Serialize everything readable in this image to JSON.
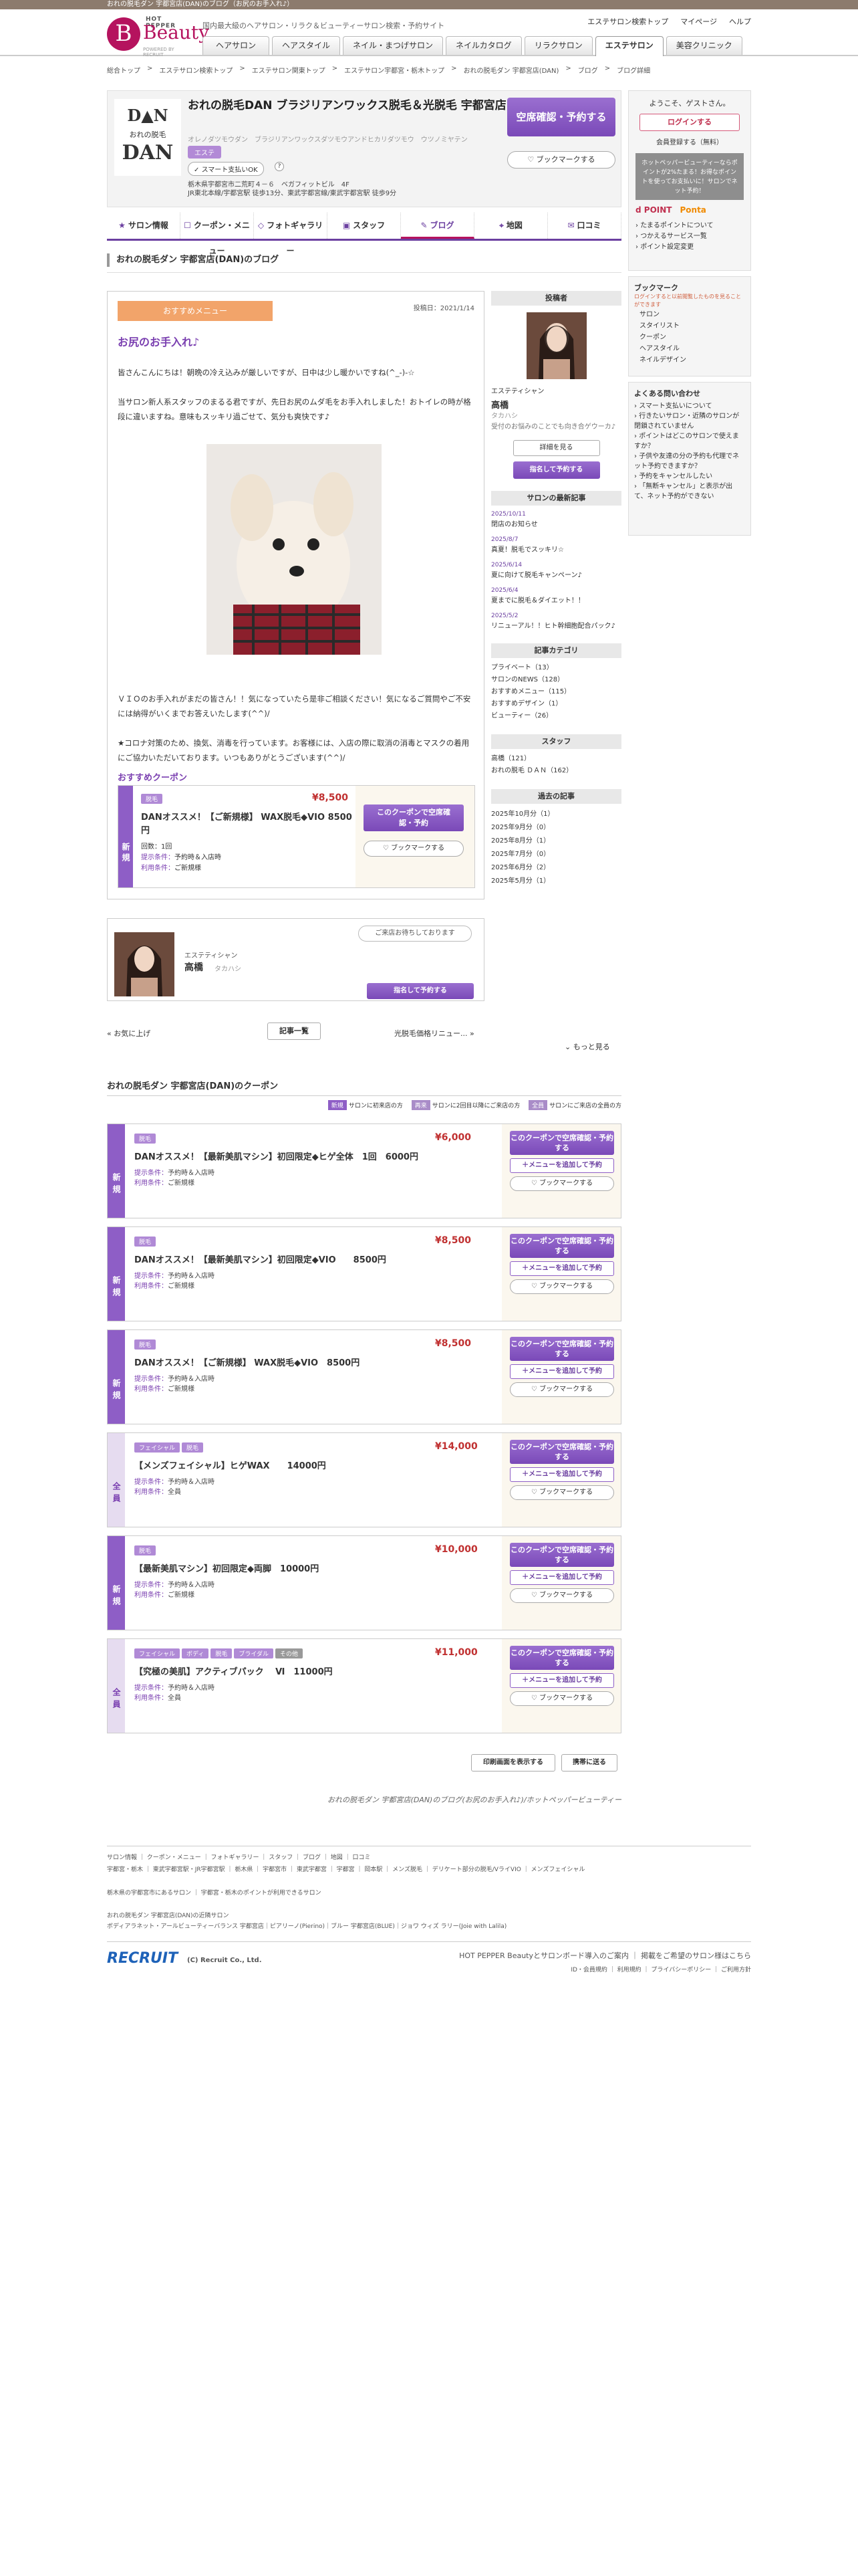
{
  "topbar": "おれの脱毛ダン 宇都宮店(DAN)のブログ（お尻のお手入れ♪）",
  "header": {
    "hp": "HOT PEPPER",
    "brand": "Beauty",
    "powered": "POWERED BY RECRUIT",
    "tagline": "国内最大級のヘアサロン・リラク＆ビューティーサロン検索・予約サイト",
    "util": [
      "エステサロン検索トップ",
      "マイページ",
      "ヘルプ"
    ],
    "nav": [
      "ヘアサロン",
      "ヘアスタイル",
      "ネイル・まつげサロン",
      "ネイルカタログ",
      "リラクサロン",
      "エステサロン",
      "美容クリニック"
    ]
  },
  "breadcrumb": [
    "総合トップ",
    "エステサロン検索トップ",
    "エステサロン関東トップ",
    "エステサロン宇都宮・栃木トップ",
    "おれの脱毛ダン 宇都宮店(DAN)",
    "ブログ",
    "ブログ詳細"
  ],
  "salon": {
    "logo1": "D▲N",
    "logo2": "おれの脱毛",
    "logo3": "DAN",
    "name": "おれの脱毛DAN ブラジリアンワックス脱毛＆光脱毛 宇都宮店",
    "kana": "オレノダツモウダン　ブラジリアンワックスダツモウアンドヒカリダツモウ　ウツノミヤテン",
    "category": "エステ",
    "pay": "スマート支払いOK",
    "q": "?",
    "addr1": "栃木県宇都宮市二荒町４－６　ベガフィットビル　4F",
    "addr2": "JR東北本線/宇都宮駅 徒歩13分、東武宇都宮線/東武宇都宮駅 徒歩9分",
    "reserve": "空席確認・予約する",
    "bookmark": "ブックマークする"
  },
  "salonnav": [
    {
      "icon": "★",
      "label": "サロン情報"
    },
    {
      "icon": "☐",
      "label": "クーポン・メニュー"
    },
    {
      "icon": "◇",
      "label": "フォトギャラリー"
    },
    {
      "icon": "▣",
      "label": "スタッフ"
    },
    {
      "icon": "✎",
      "label": "ブログ"
    },
    {
      "icon": "⌖",
      "label": "地図"
    },
    {
      "icon": "✉",
      "label": "口コミ"
    }
  ],
  "blog": {
    "heading": "おれの脱毛ダン 宇都宮店(DAN)のブログ",
    "rec": "おすすめメニュー",
    "date": "投稿日：2021/1/14",
    "title": "お尻のお手入れ♪",
    "p1": "皆さんこんにちは！朝晩の冷え込みが厳しいですが、日中は少し暖かいですね(^_-)-☆",
    "p2": "当サロン新人系スタッフのまるる君ですが、先日お尻のムダ毛をお手入れしました！おトイレの時が格段に違いますね。意味もスッキリ過ごせて、気分も爽快です♪",
    "p3": "ＶＩＯのお手入れがまだの皆さん！！気になっていたら是非ご相談ください！気になるご質問やご不安には納得がいくまでお答えいたします(^^)/",
    "p4": "★コロナ対策のため、換気、消毒を行っています。お客様には、入店の際に取消の消毒とマスクの着用にご協力いただいております。いつもありがとうございます(^^)/",
    "cphead": "おすすめクーポン",
    "cp": {
      "tag": "新規",
      "pill": "脱毛",
      "price": "¥8,500",
      "title": "DANオススメ！【ご新規様】 WAX脱毛◆VIO 8500円",
      "time": "回数：1回",
      "c1l": "提示条件：",
      "c1": "予約時＆入店時",
      "c2l": "利用条件：",
      "c2": "ご新規様",
      "b1": "このクーポンで空席確認・予約",
      "b3": "ブックマークする"
    }
  },
  "author": {
    "role": "エステティシャン",
    "name": "高橋",
    "kana": "タカハシ",
    "bubble": "ご来店お待ちしております",
    "btn": "指名して予約する"
  },
  "pager": {
    "prev": "« お気に上げ",
    "list": "記事一覧",
    "next": "光脱毛価格リニュー... »",
    "more": "もっと見る"
  },
  "side": {
    "poster": "投稿者",
    "role": "エステティシャン",
    "name": "高橋",
    "kana": "タカハシ",
    "desc": "受付のお悩みのことでも向き合ゲウーカ♪",
    "detail": "詳細を見る",
    "btn": "指名して予約する",
    "latest": "サロンの最新記事",
    "posts": [
      {
        "d": "2025/10/11",
        "t": "閉店のお知らせ"
      },
      {
        "d": "2025/8/7",
        "t": "真夏！脱毛でスッキリ☆"
      },
      {
        "d": "2025/6/14",
        "t": "夏に向けて脱毛キャンペーン♪"
      },
      {
        "d": "2025/6/4",
        "t": "夏までに脱毛＆ダイエット！！"
      },
      {
        "d": "2025/5/2",
        "t": "リニューアル！！ヒト幹細胞配合パック♪"
      }
    ],
    "cat": "記事カテゴリ",
    "cats": [
      "プライベート（13）",
      "サロンのNEWS（128）",
      "おすすめメニュー（115）",
      "おすすめデザイン（1）",
      "ビューティー（26）"
    ],
    "staff": "スタッフ",
    "staffs": [
      "高橋（121）",
      "おれの脱毛 ＤＡＮ（162）"
    ],
    "past": "過去の記事",
    "pasts": [
      "2025年10月分（1）",
      "2025年9月分（0）",
      "2025年8月分（1）",
      "2025年7月分（0）",
      "2025年6月分（2）",
      "2025年5月分（1）"
    ]
  },
  "coupons": {
    "head": "おれの脱毛ダン 宇都宮店(DAN)のクーポン",
    "legend": [
      {
        "k": "新規",
        "t": "サロンに初来店の方"
      },
      {
        "k": "再来",
        "t": "サロンに2回目以降にご来店の方"
      },
      {
        "k": "全員",
        "t": "サロンにご来店の全員の方"
      }
    ],
    "items": [
      {
        "tag": "新規",
        "pills": [
          "脱毛"
        ],
        "price": "¥6,000",
        "title": "DANオススメ！【最新美肌マシン】初回限定◆ヒゲ全体　1回　6000円",
        "c1": "予約時＆入店時",
        "c2": "ご新規様"
      },
      {
        "tag": "新規",
        "pills": [
          "脱毛"
        ],
        "price": "¥8,500",
        "title": "DANオススメ！【最新美肌マシン】初回限定◆VIO　　8500円",
        "c1": "予約時＆入店時",
        "c2": "ご新規様"
      },
      {
        "tag": "新規",
        "pills": [
          "脱毛"
        ],
        "price": "¥8,500",
        "title": "DANオススメ！【ご新規様】 WAX脱毛◆VIO　8500円",
        "c1": "予約時＆入店時",
        "c2": "ご新規様"
      },
      {
        "tag": "全員",
        "pills": [
          "フェイシャル",
          "脱毛"
        ],
        "price": "¥14,000",
        "title": "【メンズフェイシャル】ヒゲWAX　　14000円",
        "c1": "予約時＆入店時",
        "c2": "全員"
      },
      {
        "tag": "新規",
        "pills": [
          "脱毛"
        ],
        "price": "¥10,000",
        "title": "【最新美肌マシン】初回限定◆両脚　10000円",
        "c1": "予約時＆入店時",
        "c2": "ご新規様"
      },
      {
        "tag": "全員",
        "pills": [
          "フェイシャル",
          "ボディ",
          "脱毛",
          "ブライダル",
          "その他"
        ],
        "price": "¥11,000",
        "title": "【究極の美肌】アクティブパック　 Ⅵ　11000円",
        "c1": "予約時＆入店時",
        "c2": "全員"
      }
    ],
    "c1l": "提示条件：",
    "c2l": "利用条件：",
    "b1": "このクーポンで空席確認・予約する",
    "b2": "＋メニューを追加して予約",
    "b3": "ブックマークする",
    "print": "印刷画面を表示する",
    "mobile": "携帯に送る"
  },
  "caption": "おれの脱毛ダン 宇都宮店(DAN)のブログ(お尻のお手入れ♪)/ホットペッパービューティー",
  "right": {
    "welcome": "ようこそ、ゲストさん。",
    "login": "ログインする",
    "register": "会員登録する（無料）",
    "promo": "ホットペッパービューティーならポイントが2%たまる！お得なポイントを使ってお支払いに！サロンでネット予約！",
    "points": [
      "たまるポイントについて",
      "つかえるサービス一覧",
      "ポイント設定変更"
    ],
    "bmhead": "ブックマーク",
    "bmnote": "ログインすると以前閲覧したものを見ることができます",
    "bm": [
      "サロン",
      "スタイリスト",
      "クーポン",
      "ヘアスタイル",
      "ネイルデザイン"
    ],
    "faqh": "よくある問い合わせ",
    "faq": [
      "スマート支払いについて",
      "行きたいサロン・近隣のサロンが閉鎖されていません",
      "ポイントはどこのサロンで使えますか？",
      "子供や友達の分の予約も代理でネット予約できますか？",
      "予約をキャンセルしたい",
      "「無断キャンセル」と表示が出て、ネット予約ができない"
    ]
  },
  "footer": {
    "links1": [
      "サロン情報",
      "クーポン・メニュー",
      "フォトギャラリー",
      "スタッフ",
      "ブログ",
      "地図",
      "口コミ"
    ],
    "links2": [
      "宇都宮・栃木",
      "東武宇都宮駅・JR宇都宮駅",
      "栃木県",
      "宇都宮市",
      "東武宇都宮",
      "宇都宮",
      "岡本駅",
      "メンズ脱毛",
      "デリケート部分の脱毛/VライVIO",
      "メンズフェイシャル"
    ],
    "near": "栃木県の宇都宮市にあるサロン",
    "nearlink": "宇都宮・栃木のポイントが利用できるサロン",
    "near2": "おれの脱毛ダン 宇都宮店(DAN)の近隣サロン",
    "near3": "ボディアラネット・アールビューティーバランス 宇都宮店｜ピアリーノ(Pierino)｜ブルー 宇都宮店(BLUE)｜ジョワ ウィズ ラリー(Joie with Lalila)",
    "recruit": "RECRUIT",
    "copy": "(C) Recruit Co., Ltd.",
    "fr": [
      "HOT PEPPER Beautyとサロンボード導入のご案内",
      "掲載をご希望のサロン様はこちら"
    ],
    "fr2": [
      "ID・会員規約",
      "利用規約",
      "プライバシーポリシー",
      "ご利用方針"
    ]
  }
}
